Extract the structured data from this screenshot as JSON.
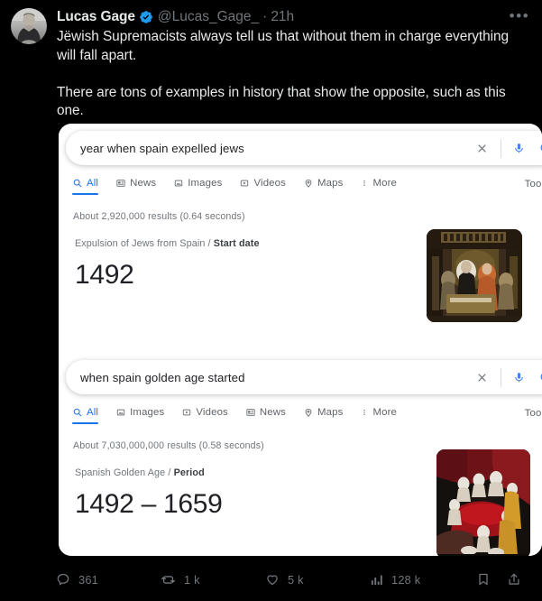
{
  "tweet": {
    "display_name": "Lucas Gage",
    "verified": true,
    "handle": "@Lucas_Gage_",
    "separator": "·",
    "timestamp": "21h",
    "more_menu": "•••",
    "text": "Jëwish Supremacists always tell us that without them in charge everything will fall apart.\n\nThere are tons of examples in history that show the opposite, such as this one."
  },
  "media": {
    "alt": "google-search-screenshot",
    "searches": [
      {
        "query": "year when spain expelled jews",
        "clear_icon": "close-icon",
        "mic_icon": "microphone-icon",
        "lens_icon": "google-lens-icon",
        "nav": [
          {
            "label": "All",
            "icon": "search-icon",
            "active": true
          },
          {
            "label": "News",
            "icon": "news-icon",
            "active": false
          },
          {
            "label": "Images",
            "icon": "image-icon",
            "active": false
          },
          {
            "label": "Videos",
            "icon": "video-icon",
            "active": false
          },
          {
            "label": "Maps",
            "icon": "map-pin-icon",
            "active": false
          },
          {
            "label": "More",
            "icon": "more-vertical-icon",
            "active": false
          }
        ],
        "tools_label": "Tools",
        "result_stats": "About 2,920,000 results (0.64 seconds)",
        "answer_entity": "Expulsion of Jews from Spain",
        "answer_slash": "/",
        "answer_property": "Start date",
        "answer_value": "1492",
        "thumbnail": "historical-painting-expulsion"
      },
      {
        "query": "when spain golden age started",
        "clear_icon": "close-icon",
        "mic_icon": "microphone-icon",
        "lens_icon": "google-lens-icon",
        "nav": [
          {
            "label": "All",
            "icon": "search-icon",
            "active": true
          },
          {
            "label": "Images",
            "icon": "image-icon",
            "active": false
          },
          {
            "label": "Videos",
            "icon": "video-icon",
            "active": false
          },
          {
            "label": "News",
            "icon": "news-icon",
            "active": false
          },
          {
            "label": "Maps",
            "icon": "map-pin-icon",
            "active": false
          },
          {
            "label": "More",
            "icon": "more-vertical-icon",
            "active": false
          }
        ],
        "tools_label": "Tools",
        "result_stats": "About 7,030,000,000 results (0.58 seconds)",
        "answer_entity": "Spanish Golden Age",
        "answer_slash": "/",
        "answer_property": "Period",
        "answer_value": "1492 – 1659",
        "thumbnail": "historical-painting-golden-age"
      }
    ]
  },
  "actions": {
    "reply": {
      "icon": "reply-icon",
      "count": "361"
    },
    "retweet": {
      "icon": "retweet-icon",
      "count": "1 k"
    },
    "like": {
      "icon": "heart-icon",
      "count": "5 k"
    },
    "views": {
      "icon": "analytics-icon",
      "count": "128 k"
    },
    "bookmark": {
      "icon": "bookmark-icon",
      "count": ""
    },
    "share": {
      "icon": "share-icon",
      "count": ""
    }
  },
  "colors": {
    "background": "#000000",
    "text": "#e7e9ea",
    "muted": "#71767b",
    "verified_blue": "#1d9bf0",
    "google_blue": "#1a73e8",
    "google_text": "#202124",
    "google_muted": "#70757a"
  }
}
